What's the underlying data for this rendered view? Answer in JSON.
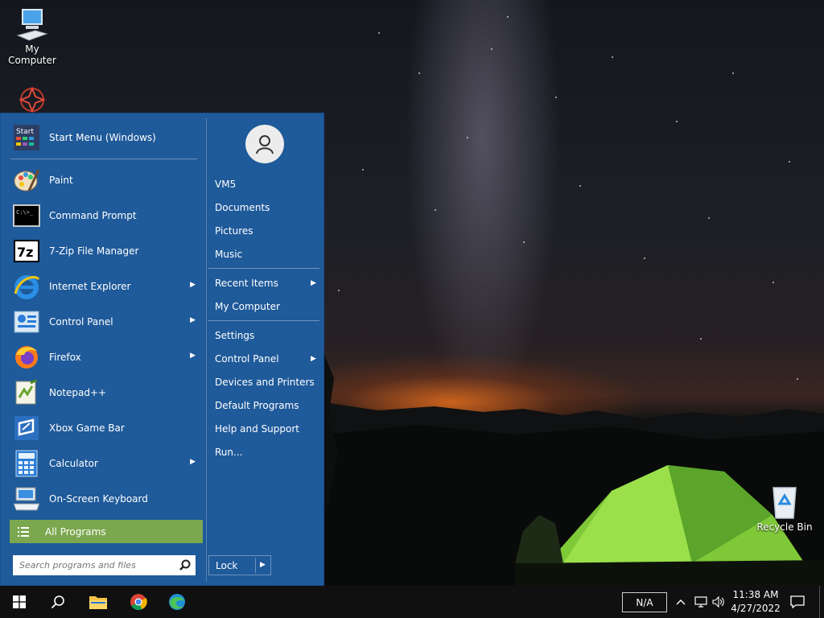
{
  "desktop": {
    "icons": [
      {
        "label": "My Computer"
      },
      {
        "label": ""
      },
      {
        "label": "Recycle Bin"
      }
    ]
  },
  "start_menu": {
    "pinned": [
      {
        "label": "Start Menu (Windows)",
        "icon": "start-menu-icon",
        "has_arrow": false
      },
      {
        "label": "Paint",
        "icon": "paint-icon",
        "has_arrow": false
      },
      {
        "label": "Command Prompt",
        "icon": "command-prompt-icon",
        "has_arrow": false
      },
      {
        "label": "7-Zip File Manager",
        "icon": "seven-zip-icon",
        "has_arrow": false
      },
      {
        "label": "Internet Explorer",
        "icon": "internet-explorer-icon",
        "has_arrow": true
      },
      {
        "label": "Control Panel",
        "icon": "control-panel-icon",
        "has_arrow": true
      },
      {
        "label": "Firefox",
        "icon": "firefox-icon",
        "has_arrow": true
      },
      {
        "label": "Notepad++",
        "icon": "notepadpp-icon",
        "has_arrow": false
      },
      {
        "label": "Xbox Game Bar",
        "icon": "xbox-game-bar-icon",
        "has_arrow": false
      },
      {
        "label": "Calculator",
        "icon": "calculator-icon",
        "has_arrow": true
      },
      {
        "label": "On-Screen Keyboard",
        "icon": "on-screen-keyboard-icon",
        "has_arrow": false
      }
    ],
    "start_icon_text": "Start",
    "cmd_icon_text": "C:\\>_",
    "zip_icon_text": "7z",
    "all_programs_label": "All Programs",
    "search_placeholder": "Search programs and files",
    "right_items": {
      "user": "VM5",
      "documents": "Documents",
      "pictures": "Pictures",
      "music": "Music",
      "recent_items": "Recent Items",
      "my_computer": "My Computer",
      "settings": "Settings",
      "control_panel": "Control Panel",
      "devices_printers": "Devices and Printers",
      "default_programs": "Default Programs",
      "help_support": "Help and Support",
      "run": "Run..."
    },
    "lock_label": "Lock"
  },
  "taskbar": {
    "tray_na": "N/A",
    "time": "11:38 AM",
    "date": "4/27/2022"
  },
  "colors": {
    "menu_bg": "#1f5a9a",
    "all_programs_bg": "#7ba84f",
    "taskbar_bg": "#101010"
  }
}
